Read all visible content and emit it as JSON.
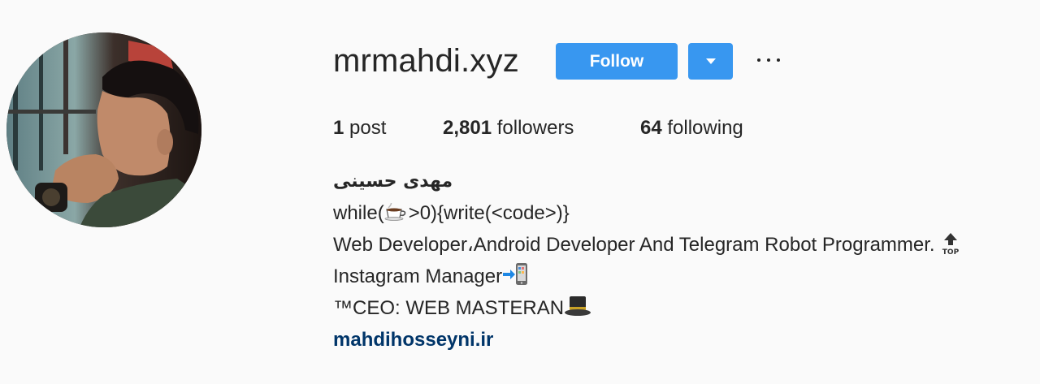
{
  "profile": {
    "username": "mrmahdi.xyz",
    "follow_label": "Follow",
    "more_label": "..."
  },
  "stats": {
    "posts_count": "1",
    "posts_label": "post",
    "followers_count": "2,801",
    "followers_label": "followers",
    "following_count": "64",
    "following_label": "following"
  },
  "bio": {
    "full_name": "مهدی حسینی",
    "line1_prefix": "while(",
    "line1_suffix": ">0){write(<code>)}",
    "line2": "Web Developer،Android Developer And Telegram Robot Programmer.",
    "line3": "Instagram Manager",
    "line4": "™CEO: WEB MASTERAN",
    "website": "mahdihosseyni.ir",
    "top_icon_text": "TOP"
  },
  "icons": {
    "coffee": "coffee-icon",
    "top": "top-arrow-icon",
    "phone": "mobile-phone-arrow-icon",
    "hat": "top-hat-icon",
    "more": "more-options-icon",
    "dropdown": "chevron-down-icon"
  },
  "colors": {
    "accent": "#3897f0",
    "link": "#003569",
    "text": "#262626",
    "background": "#fafafa"
  }
}
